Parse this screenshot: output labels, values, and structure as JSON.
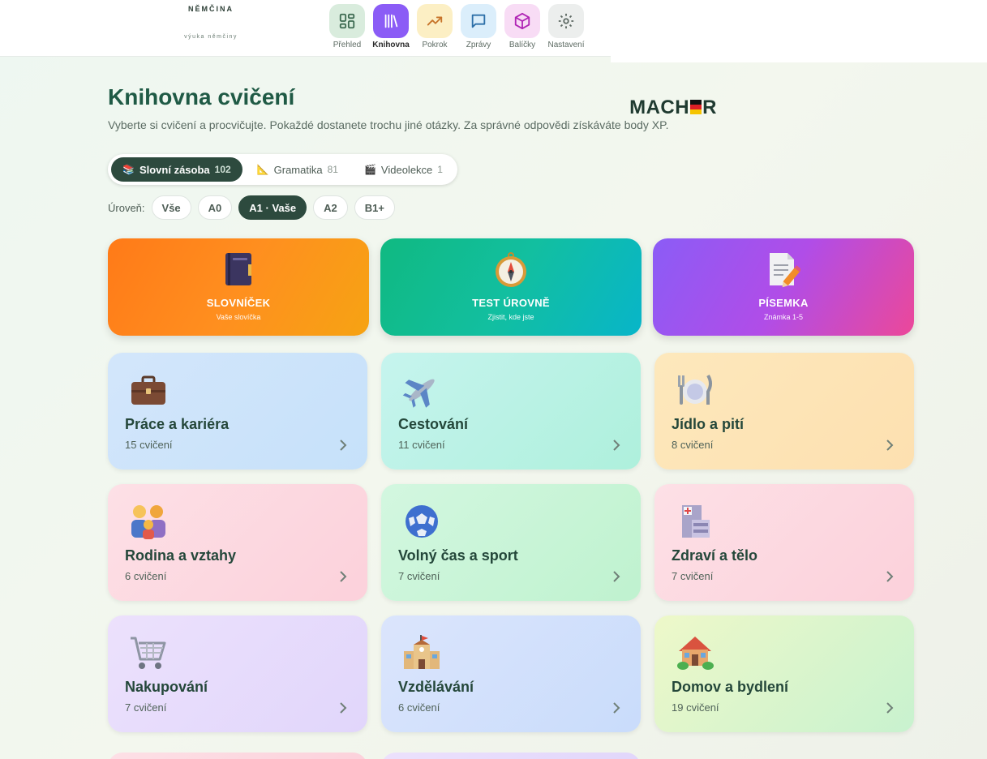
{
  "logo": {
    "top": "NĚMČINA",
    "main_left": "MACH",
    "main_right": "R",
    "sub": "výuka němčiny"
  },
  "nav": [
    {
      "label": "Přehled",
      "icon": "dashboard-icon"
    },
    {
      "label": "Knihovna",
      "icon": "library-icon",
      "active": true
    },
    {
      "label": "Pokrok",
      "icon": "trending-up-icon"
    },
    {
      "label": "Zprávy",
      "icon": "message-icon"
    },
    {
      "label": "Balíčky",
      "icon": "package-icon"
    },
    {
      "label": "Nastavení",
      "icon": "gear-icon"
    }
  ],
  "page": {
    "title": "Knihovna cvičení",
    "description": "Vyberte si cvičení a procvičujte. Pokaždé dostanete trochu jiné otázky. Za správné odpovědi získáváte body XP."
  },
  "tabs": [
    {
      "label": "Slovní zásoba",
      "count": "102",
      "icon": "📚",
      "active": true
    },
    {
      "label": "Gramatika",
      "count": "81",
      "icon": "📐"
    },
    {
      "label": "Videolekce",
      "count": "1",
      "icon": "🎬"
    }
  ],
  "levels": {
    "label": "Úroveň:",
    "options": [
      "Vše",
      "A0",
      "A1 · Vaše",
      "A2",
      "B1+"
    ],
    "selected": "A1 · Vaše"
  },
  "features": [
    {
      "title": "SLOVNÍČEK",
      "subtitle": "Vaše slovíčka",
      "icon": "notebook-icon"
    },
    {
      "title": "TEST ÚROVNĚ",
      "subtitle": "Zjistit, kde jste",
      "icon": "compass-icon"
    },
    {
      "title": "PÍSEMKA",
      "subtitle": "Známka 1-5",
      "icon": "document-pencil-icon"
    }
  ],
  "categories": [
    {
      "title": "Práce a kariéra",
      "count": "15 cvičení",
      "icon": "briefcase-icon"
    },
    {
      "title": "Cestování",
      "count": "11 cvičení",
      "icon": "airplane-icon"
    },
    {
      "title": "Jídlo a pití",
      "count": "8 cvičení",
      "icon": "plate-cutlery-icon"
    },
    {
      "title": "Rodina a vztahy",
      "count": "6 cvičení",
      "icon": "family-icon"
    },
    {
      "title": "Volný čas a sport",
      "count": "7 cvičení",
      "icon": "soccer-ball-icon"
    },
    {
      "title": "Zdraví a tělo",
      "count": "7 cvičení",
      "icon": "hospital-icon"
    },
    {
      "title": "Nakupování",
      "count": "7 cvičení",
      "icon": "shopping-cart-icon"
    },
    {
      "title": "Vzdělávání",
      "count": "6 cvičení",
      "icon": "school-icon"
    },
    {
      "title": "Domov a bydlení",
      "count": "19 cvičení",
      "icon": "house-icon"
    }
  ]
}
